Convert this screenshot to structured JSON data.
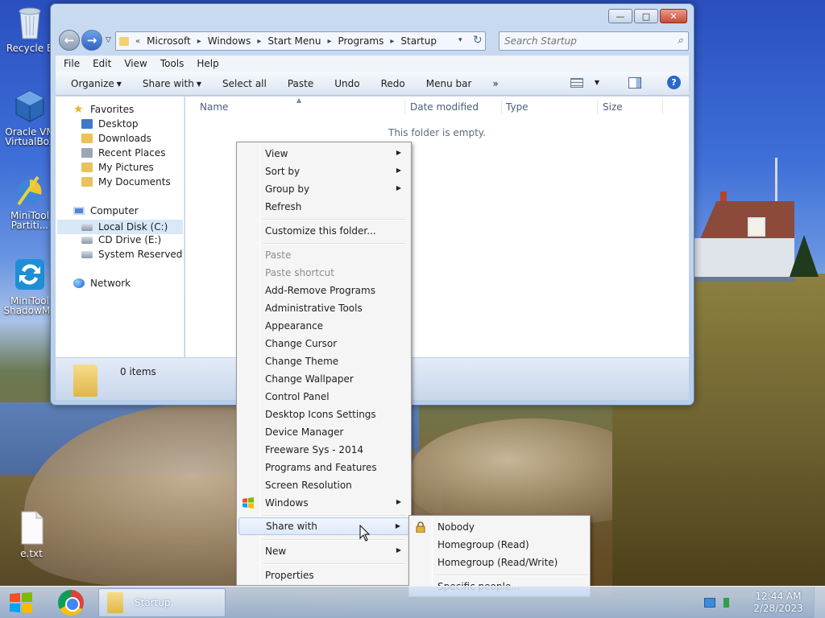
{
  "desktop": {
    "icons": [
      {
        "label": "Recycle B",
        "icon": "recycle-bin-icon"
      },
      {
        "label": "Oracle VM\nVirtualBox",
        "icon": "virtualbox-icon"
      },
      {
        "label": "MiniTool\nPartiti...",
        "icon": "minitool-partition-icon"
      },
      {
        "label": "MiniTool\nShadowMa",
        "icon": "minitool-shadowmaker-icon"
      },
      {
        "label": "e.txt",
        "icon": "text-file-icon"
      }
    ]
  },
  "window": {
    "title_buttons": {
      "minimize": "—",
      "maximize": "□",
      "close": "✕"
    },
    "address": {
      "prefix": "«",
      "crumbs": [
        "Microsoft",
        "Windows",
        "Start Menu",
        "Programs",
        "Startup"
      ]
    },
    "search_placeholder": "Search Startup",
    "menubar": [
      "File",
      "Edit",
      "View",
      "Tools",
      "Help"
    ],
    "toolbar": {
      "organize": "Organize",
      "share_with": "Share with",
      "select_all": "Select all",
      "paste": "Paste",
      "undo": "Undo",
      "redo": "Redo",
      "menu_bar": "Menu bar",
      "more": "»"
    },
    "navpane": {
      "favorites": "Favorites",
      "desktop": "Desktop",
      "downloads": "Downloads",
      "recent_places": "Recent Places",
      "my_pictures": "My Pictures",
      "my_documents": "My Documents",
      "computer": "Computer",
      "local_disk": "Local Disk (C:)",
      "cd_drive": "CD Drive (E:)",
      "system_reserved": "System Reserved (",
      "network": "Network"
    },
    "columns": {
      "name": "Name",
      "date_modified": "Date modified",
      "type": "Type",
      "size": "Size"
    },
    "empty_message": "This folder is empty.",
    "item_count": "0 items"
  },
  "context_menu": {
    "items": [
      {
        "label": "View",
        "submenu": true
      },
      {
        "label": "Sort by",
        "submenu": true
      },
      {
        "label": "Group by",
        "submenu": true
      },
      {
        "label": "Refresh"
      },
      {
        "label": "Customize this folder..."
      },
      {
        "label": "Paste",
        "disabled": true
      },
      {
        "label": "Paste shortcut",
        "disabled": true
      },
      {
        "label": "Add-Remove Programs"
      },
      {
        "label": "Administrative Tools"
      },
      {
        "label": "Appearance"
      },
      {
        "label": "Change Cursor"
      },
      {
        "label": "Change Theme"
      },
      {
        "label": "Change Wallpaper"
      },
      {
        "label": "Control Panel"
      },
      {
        "label": "Desktop Icons Settings"
      },
      {
        "label": "Device Manager"
      },
      {
        "label": "Freeware Sys - 2014"
      },
      {
        "label": "Programs and Features"
      },
      {
        "label": "Screen Resolution"
      },
      {
        "label": "Windows",
        "submenu": true
      },
      {
        "label": "Share with",
        "submenu": true,
        "highlighted": true
      },
      {
        "label": "New",
        "submenu": true
      },
      {
        "label": "Properties"
      }
    ],
    "share_submenu": [
      "Nobody",
      "Homegroup (Read)",
      "Homegroup (Read/Write)",
      "Specific people..."
    ]
  },
  "taskbar": {
    "task_label": "Startup",
    "time": "12:44 AM",
    "date": "2/28/2023"
  },
  "colors": {
    "menu_highlight": "#dde9f9",
    "accent": "#2c63c6",
    "disabled_text": "#8d8d8d"
  }
}
